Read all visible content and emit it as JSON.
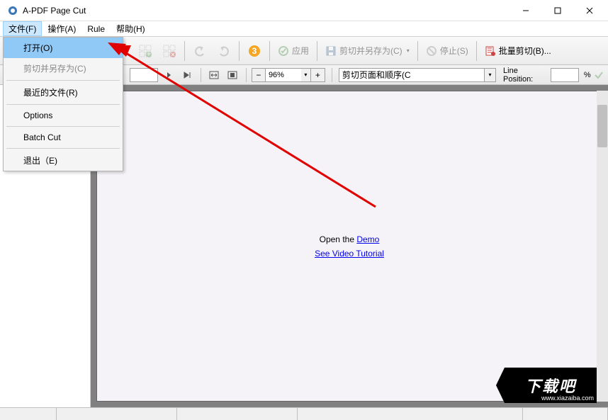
{
  "window": {
    "title": "A-PDF Page Cut"
  },
  "menubar": {
    "items": [
      "文件(F)",
      "操作(A)",
      "Rule",
      "帮助(H)"
    ]
  },
  "dropdown": {
    "items": [
      {
        "label": "打开(O)",
        "highlighted": true
      },
      {
        "label": "剪切并另存为(C)",
        "disabled": true
      },
      {
        "sep": true
      },
      {
        "label": "最近的文件(R)"
      },
      {
        "sep": true
      },
      {
        "label": "Options"
      },
      {
        "sep": true
      },
      {
        "label": "Batch Cut"
      },
      {
        "sep": true
      },
      {
        "label": "退出（E)"
      }
    ]
  },
  "toolbar1": {
    "apply_label": "应用",
    "saveas_label": "剪切并另存为(C)",
    "stop_label": "停止(S)",
    "batch_label": "批量剪切(B)..."
  },
  "toolbar2": {
    "page_input": "",
    "zoom_value": "96%",
    "combo_label": "剪切页面和顺序(C",
    "line_position_label": "Line Position:",
    "line_position_value": "",
    "line_position_unit": "%"
  },
  "doc": {
    "open_text": "Open the ",
    "demo_link": "Demo",
    "tutorial_link": "See Video Tutorial "
  },
  "watermark": {
    "text": "下载吧",
    "url": "www.xiazaiba.com"
  }
}
